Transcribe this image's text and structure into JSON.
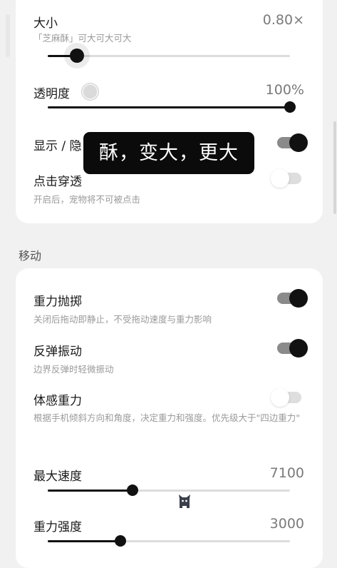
{
  "display": {
    "size": {
      "label": "大小",
      "value": "0.80×",
      "hint": "「芝麻酥」可大可大可大",
      "level": 0.12
    },
    "opacity": {
      "label": "透明度",
      "value": "100%",
      "level": 1.0
    },
    "show_hide": {
      "label": "显示 / 隐",
      "on": true
    },
    "click_through": {
      "label": "点击穿透",
      "hint": "开启后，宠物将不可被点击",
      "on": false
    }
  },
  "toast": {
    "text": "酥，变大，更大"
  },
  "move": {
    "section_title": "移动",
    "gravity_throw": {
      "label": "重力抛掷",
      "hint": "关闭后拖动即静止，不受拖动速度与重力影响",
      "on": true
    },
    "bounce_vibrate": {
      "label": "反弹振动",
      "hint": "边界反弹时轻微振动",
      "on": true
    },
    "motion_gravity": {
      "label": "体感重力",
      "hint": "根据手机倾斜方向和角度，决定重力和强度。优先级大于\"四边重力\"",
      "on": false
    },
    "max_speed": {
      "label": "最大速度",
      "value": "7100",
      "level": 0.35
    },
    "gravity_strength": {
      "label": "重力强度",
      "value": "3000",
      "level": 0.3
    }
  },
  "colors": {
    "accent": "#111111",
    "card": "#ffffff",
    "background": "#f1f1f1",
    "toast_bg": "#0b0b0b"
  },
  "icons": {
    "pet": "cat-pet-icon"
  }
}
